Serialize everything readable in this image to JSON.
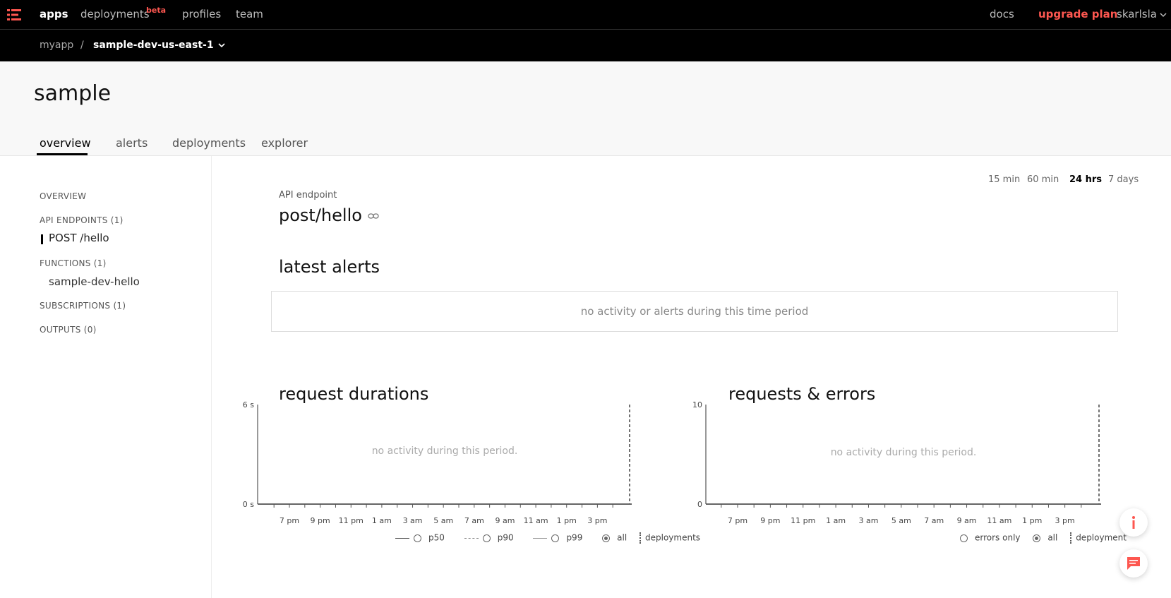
{
  "topnav": {
    "items": [
      {
        "label": "apps"
      },
      {
        "label": "deployments",
        "badge": "beta"
      },
      {
        "label": "profiles"
      },
      {
        "label": "team"
      }
    ],
    "docs": "docs",
    "upgrade": "upgrade plan",
    "user": "skarlsla"
  },
  "breadcrumb": {
    "app": "myapp",
    "sep": "/",
    "service": "sample-dev-us-east-1"
  },
  "page": {
    "title": "sample",
    "tabs": [
      "overview",
      "alerts",
      "deployments",
      "explorer"
    ]
  },
  "sidebar": {
    "overview": "OVERVIEW",
    "api_endpoints": "API ENDPOINTS (1)",
    "api_item": "POST /hello",
    "functions": "FUNCTIONS (1)",
    "function_item": "sample-dev-hello",
    "subscriptions": "SUBSCRIPTIONS (1)",
    "outputs": "OUTPUTS (0)"
  },
  "timerange": [
    "15 min",
    "60 min",
    "24 hrs",
    "7 days"
  ],
  "endpoint": {
    "label": "API endpoint",
    "title": "post/hello"
  },
  "alerts": {
    "heading": "latest alerts",
    "empty": "no activity or alerts during this time period"
  },
  "durations": {
    "heading": "request durations",
    "empty": "no activity during this period.",
    "legend": [
      "p50",
      "p90",
      "p99",
      "all",
      "deployments"
    ]
  },
  "requests": {
    "heading": "requests & errors",
    "empty": "no activity during this period.",
    "legend": [
      "errors only",
      "all",
      "deployment"
    ]
  },
  "chart_data": [
    {
      "type": "line",
      "title": "request durations",
      "x": [
        "7 pm",
        "9 pm",
        "11 pm",
        "1 am",
        "3 am",
        "5 am",
        "7 am",
        "9 am",
        "11 am",
        "1 pm",
        "3 pm"
      ],
      "series": [],
      "yticks": [
        "0 s",
        "6 s"
      ],
      "ylim": [
        0,
        6
      ],
      "grid": false
    },
    {
      "type": "bar",
      "title": "requests & errors",
      "x": [
        "7 pm",
        "9 pm",
        "11 pm",
        "1 am",
        "3 am",
        "5 am",
        "7 am",
        "9 am",
        "11 am",
        "1 pm",
        "3 pm"
      ],
      "series": [],
      "yticks": [
        "0",
        "10"
      ],
      "ylim": [
        0,
        10
      ],
      "grid": false
    }
  ],
  "colors": {
    "accent": "#fd5750",
    "navbar": "#000000"
  },
  "icons": {
    "logo": "serverless-logo-icon",
    "link": "link-icon",
    "info": "info-icon",
    "chat": "chat-icon",
    "chevron": "chevron-down-icon"
  }
}
